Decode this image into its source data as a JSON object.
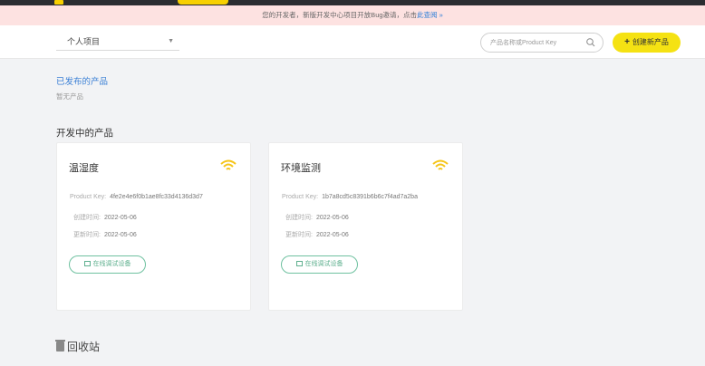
{
  "notice": {
    "text": "您的开发者，新版开发中心项目开放Bug邀请，点击",
    "link": "此查阅 »"
  },
  "toolbar": {
    "project_select": "个人项目",
    "search_placeholder": "产品名称或Product Key",
    "create_button": "创建新产品"
  },
  "published": {
    "link": "已发布的产品",
    "empty": "暂无产品"
  },
  "section_title": "开发中的产品",
  "cards": [
    {
      "name": "温湿度",
      "product_key_label": "Product Key:",
      "product_key": "4fe2e4e6f0b1ae8fc33d4136d3d7",
      "created_label": "创建时间:",
      "created": "2022-05-06",
      "updated_label": "更新时间:",
      "updated": "2022-05-06",
      "debug_button": "在线调试设备"
    },
    {
      "name": "环境监测",
      "product_key_label": "Product Key:",
      "product_key": "1b7a8cd5c8391b6b6c7f4ad7a2ba",
      "created_label": "创建时间:",
      "created": "2022-05-06",
      "updated_label": "更新时间:",
      "updated": "2022-05-06",
      "debug_button": "在线调试设备"
    }
  ],
  "recycle_bin": "回收站",
  "colors": {
    "accent_yellow": "#f5e213",
    "wifi_icon": "#f5c518",
    "link_blue": "#3a7fd5",
    "debug_green": "#5fb08f"
  }
}
